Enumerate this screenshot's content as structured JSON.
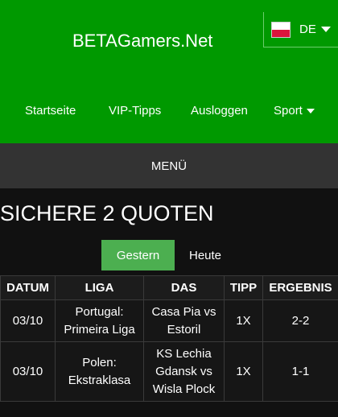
{
  "header": {
    "site_title": "BETAGamers.Net",
    "language": {
      "code": "DE",
      "flag": "german-flag-icon"
    },
    "nav": [
      {
        "label": "Startseite"
      },
      {
        "label": "VIP-Tipps"
      },
      {
        "label": "Ausloggen"
      },
      {
        "label": "Sport",
        "has_dropdown": true
      }
    ]
  },
  "menu": {
    "label": "MENÜ"
  },
  "main": {
    "title": "SICHERE 2 QUOTEN",
    "tabs": [
      {
        "label": "Gestern",
        "active": true
      },
      {
        "label": "Heute",
        "active": false
      }
    ],
    "table": {
      "columns": [
        "DATUM",
        "LIGA",
        "DAS",
        "TIPP",
        "ERGEBNIS"
      ],
      "rows": [
        {
          "date": "03/10",
          "league": "Portugal: Primeira Liga",
          "match": "Casa Pia vs Estoril",
          "tip": "1X",
          "result": "2-2"
        },
        {
          "date": "03/10",
          "league": "Polen: Ekstraklasa",
          "match": "KS Lechia Gdansk vs Wisla Plock",
          "tip": "1X",
          "result": "1-1"
        }
      ]
    }
  },
  "colors": {
    "header_green": "#009900",
    "active_tab": "#4caf50",
    "menu_bar": "#333333",
    "background": "#111111"
  }
}
